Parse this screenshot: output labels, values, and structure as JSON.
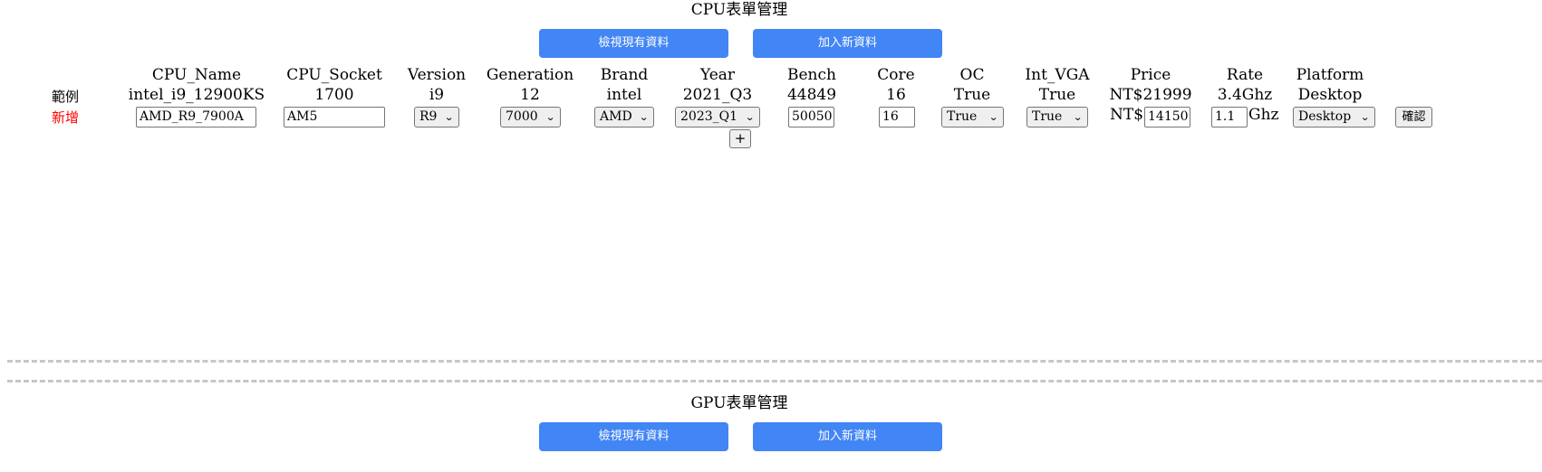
{
  "cpu": {
    "title": "CPU表單管理",
    "view_button": "檢視現有資料",
    "add_button": "加入新資料",
    "example_label": "範例",
    "new_label": "新增",
    "columns": [
      {
        "header": "CPU_Name",
        "example": "intel_i9_12900KS"
      },
      {
        "header": "CPU_Socket",
        "example": "1700"
      },
      {
        "header": "Version",
        "example": "i9"
      },
      {
        "header": "Generation",
        "example": "12"
      },
      {
        "header": "Brand",
        "example": "intel"
      },
      {
        "header": "Year",
        "example": "2021_Q3"
      },
      {
        "header": "Bench",
        "example": "44849"
      },
      {
        "header": "Core",
        "example": "16"
      },
      {
        "header": "OC",
        "example": "True"
      },
      {
        "header": "Int_VGA",
        "example": "True"
      },
      {
        "header": "Price",
        "example": "NT$21999"
      },
      {
        "header": "Rate",
        "example": "3.4Ghz"
      },
      {
        "header": "Platform",
        "example": "Desktop"
      }
    ],
    "form": {
      "cpu_name": "AMD_R9_7900A",
      "cpu_socket": "AM5",
      "version": "R9",
      "generation": "7000",
      "brand": "AMD",
      "year": "2023_Q1",
      "bench": "50050",
      "core": "16",
      "oc": "True",
      "int_vga": "True",
      "price_prefix": "NT$",
      "price": "14150",
      "rate": "1.1",
      "rate_unit": "Ghz",
      "platform": "Desktop",
      "plus_label": "+",
      "confirm_label": "確認"
    }
  },
  "gpu": {
    "title": "GPU表單管理",
    "view_button": "檢視現有資料",
    "add_button": "加入新資料"
  },
  "colors": {
    "button": "#4285f4",
    "new_label": "#ff0000",
    "divider": "#c7c7c7"
  }
}
